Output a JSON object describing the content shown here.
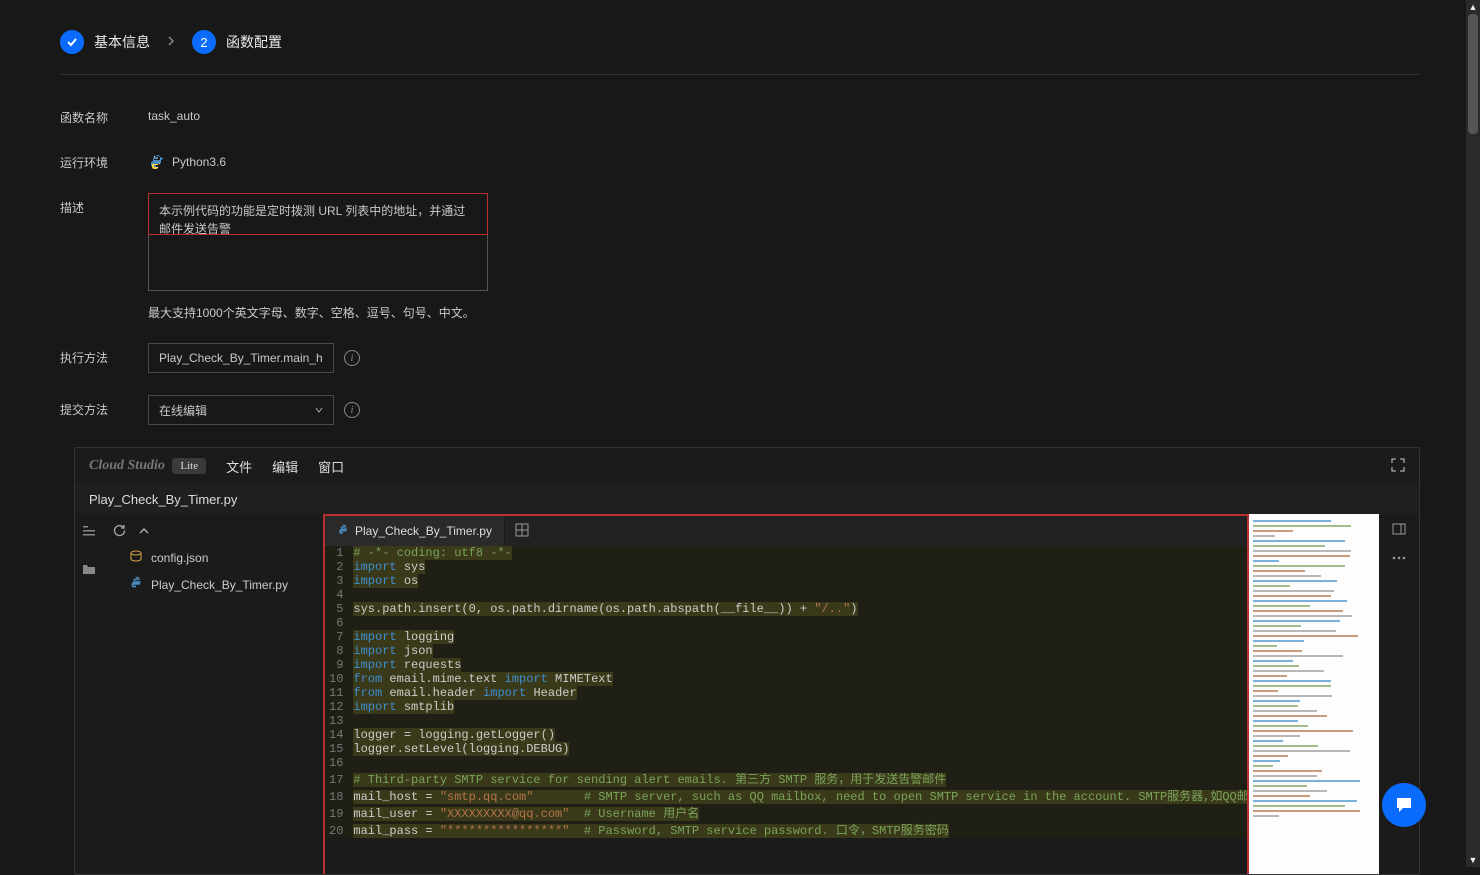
{
  "steps": {
    "s1": {
      "label": "基本信息"
    },
    "s2": {
      "num": "2",
      "label": "函数配置"
    }
  },
  "form": {
    "name_label": "函数名称",
    "name_value": "task_auto",
    "env_label": "运行环境",
    "env_value": "Python3.6",
    "desc_label": "描述",
    "desc_value": "本示例代码的功能是定时拨测 URL 列表中的地址，并通过邮件发送告警",
    "desc_hint": "最大支持1000个英文字母、数字、空格、逗号、句号、中文。",
    "exec_label": "执行方法",
    "exec_value": "Play_Check_By_Timer.main_han",
    "submit_label": "提交方法",
    "submit_value": "在线编辑"
  },
  "editor": {
    "brand": "Cloud Studio",
    "brand_pill": "Lite",
    "menu": {
      "file": "文件",
      "edit": "编辑",
      "window": "窗口"
    },
    "open_file": "Play_Check_By_Timer.py",
    "files": {
      "config": "config.json",
      "script": "Play_Check_By_Timer.py"
    },
    "tab": "Play_Check_By_Timer.py"
  },
  "code": [
    {
      "n": 1,
      "c": "# -*- coding: utf8 -*-",
      "cls": "tk-c"
    },
    {
      "n": 2,
      "c": "import sys",
      "kw": "import",
      "rest": " sys"
    },
    {
      "n": 3,
      "c": "import os",
      "kw": "import",
      "rest": " os"
    },
    {
      "n": 4,
      "c": ""
    },
    {
      "n": 5,
      "c": "sys.path.insert(0, os.path.dirname(os.path.abspath(__file__)) + \"/..\")",
      "plain": true,
      "str": "\"/..\""
    },
    {
      "n": 6,
      "c": ""
    },
    {
      "n": 7,
      "c": "import logging",
      "kw": "import",
      "rest": " logging"
    },
    {
      "n": 8,
      "c": "import json",
      "kw": "import",
      "rest": " json"
    },
    {
      "n": 9,
      "c": "import requests",
      "kw": "import",
      "rest": " requests"
    },
    {
      "n": 10,
      "c": "from email.mime.text import MIMEText",
      "kw": "from",
      "mid": " email.mime.text ",
      "kw2": "import",
      "rest": " MIMEText"
    },
    {
      "n": 11,
      "c": "from email.header import Header",
      "kw": "from",
      "mid": " email.header ",
      "kw2": "import",
      "rest": " Header"
    },
    {
      "n": 12,
      "c": "import smtplib",
      "kw": "import",
      "rest": " smtplib"
    },
    {
      "n": 13,
      "c": ""
    },
    {
      "n": 14,
      "c": "logger = logging.getLogger()",
      "plain": true
    },
    {
      "n": 15,
      "c": "logger.setLevel(logging.DEBUG)",
      "plain": true
    },
    {
      "n": 16,
      "c": ""
    },
    {
      "n": 17,
      "c": "# Third-party SMTP service for sending alert emails. 第三方 SMTP 服务，用于发送告警邮件",
      "cls": "tk-c"
    },
    {
      "n": 18,
      "pre": "mail_host = ",
      "str": "\"smtp.qq.com\"",
      "cmt": "       # SMTP server, such as QQ mailbox, need to open SMTP service in the account. SMTP服务器,如QQ邮箱，需要在账户里开启SMTP服务"
    },
    {
      "n": 19,
      "pre": "mail_user = ",
      "str": "\"XXXXXXXXX@qq.com\"",
      "cmt": "  # Username 用户名"
    },
    {
      "n": 20,
      "pre": "mail_pass = ",
      "str": "\"****************\"",
      "cmt": "  # Password, SMTP service password. 口令，SMTP服务密码"
    }
  ]
}
